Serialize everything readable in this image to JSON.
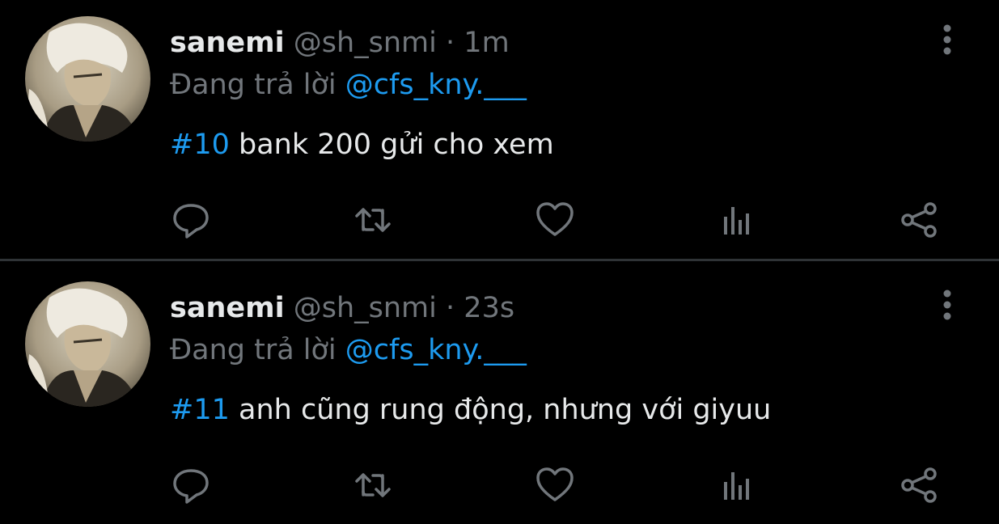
{
  "colors": {
    "background": "#000000",
    "name": "#e7e9ea",
    "secondary": "#71767b",
    "accent": "#1d9bf0",
    "divider": "#2f3336"
  },
  "tweets": [
    {
      "display_name": "sanemi",
      "handle": "@sh_snmi",
      "separator": "·",
      "time": "1m",
      "replying_label": "Đang trả lời",
      "replying_to": "@cfs_kny.___",
      "hashtag": "#10",
      "text": "bank 200 gửi cho xem",
      "icons": [
        "more-vertical-icon",
        "reply-icon",
        "retweet-icon",
        "like-icon",
        "stats-icon",
        "share-icon"
      ]
    },
    {
      "display_name": "sanemi",
      "handle": "@sh_snmi",
      "separator": "·",
      "time": "23s",
      "replying_label": "Đang trả lời",
      "replying_to": "@cfs_kny.___",
      "hashtag": "#11",
      "text": "anh cũng rung động, nhưng với giyuu",
      "icons": [
        "more-vertical-icon",
        "reply-icon",
        "retweet-icon",
        "like-icon",
        "stats-icon",
        "share-icon"
      ]
    }
  ]
}
